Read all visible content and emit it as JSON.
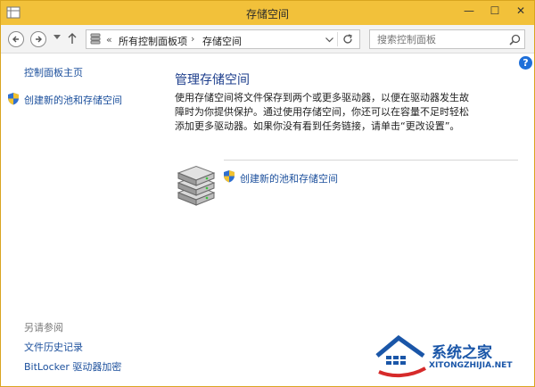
{
  "window": {
    "title": "存储空间",
    "controls": {
      "minimize": "—",
      "maximize": "☐",
      "close": "✕"
    }
  },
  "nav": {
    "back_icon": "back-arrow-icon",
    "forward_icon": "forward-arrow-icon",
    "up_icon": "up-arrow-icon",
    "breadcrumb": {
      "separator_root": "«",
      "items": [
        "所有控制面板项",
        "存储空间"
      ],
      "separator": "›"
    },
    "search_placeholder": "搜索控制面板"
  },
  "help_label": "?",
  "sidebar": {
    "home": "控制面板主页",
    "create": "创建新的池和存储空间",
    "see_also_heading": "另请参阅",
    "see_also": [
      "文件历史记录",
      "BitLocker 驱动器加密"
    ]
  },
  "main": {
    "title": "管理存储空间",
    "description": "使用存储空间将文件保存到两个或更多驱动器，以便在驱动器发生故障时为你提供保护。通过使用存储空间，你还可以在容量不足时轻松添加更多驱动器。如果你没有看到任务链接，请单击“更改设置”。",
    "create_link": "创建新的池和存储空间"
  },
  "watermark": {
    "text": "系统之家",
    "url": "XITONGZHIJIA.NET"
  },
  "colors": {
    "titlebar": "#f2c13a",
    "link": "#1b4f9c",
    "heading": "#1d3e8c"
  }
}
